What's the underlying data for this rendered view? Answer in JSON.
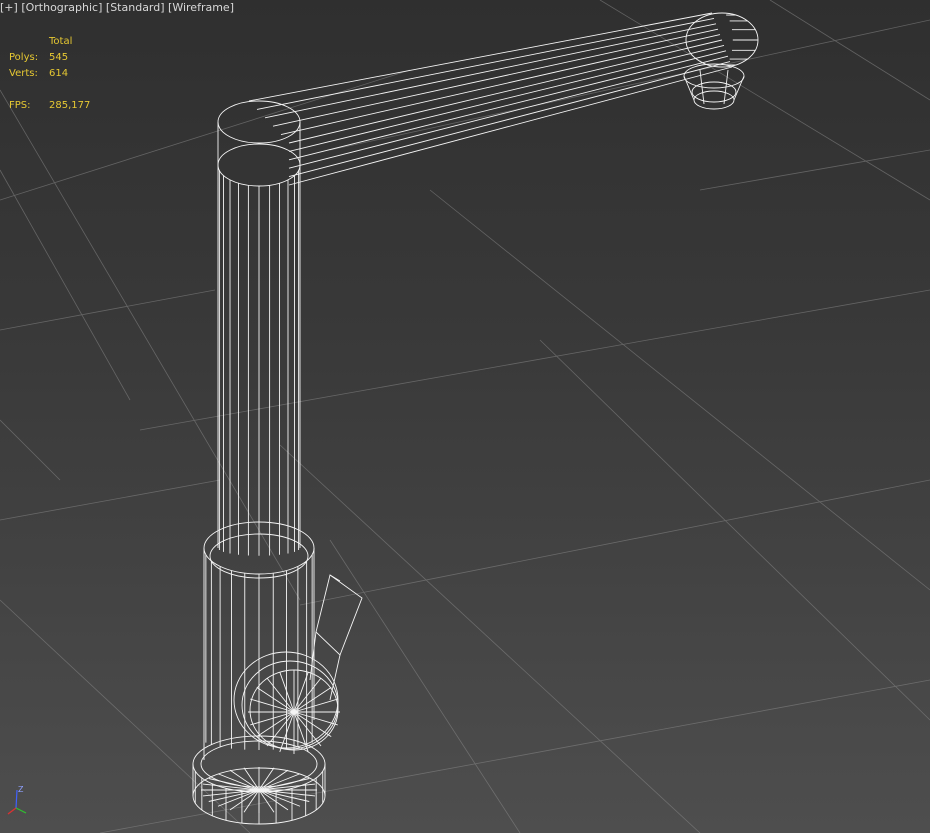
{
  "viewport_labels": {
    "plus": "[+]",
    "view": "[Orthographic]",
    "shading_style": "[Standard]",
    "render_mode": "[Wireframe]"
  },
  "statistics": {
    "header": "Total",
    "polys_label": "Polys:",
    "polys_value": "545",
    "verts_label": "Verts:",
    "verts_value": "614",
    "fps_label": "FPS:",
    "fps_value": "285,177"
  },
  "axis_gizmo": {
    "z_label": "Z"
  },
  "colors": {
    "stats_text": "#e6c832",
    "wireframe": "#ffffff",
    "grid": "#8a8a8a",
    "axis_x": "#e03030",
    "axis_y": "#30c030",
    "axis_z": "#4060ff"
  }
}
